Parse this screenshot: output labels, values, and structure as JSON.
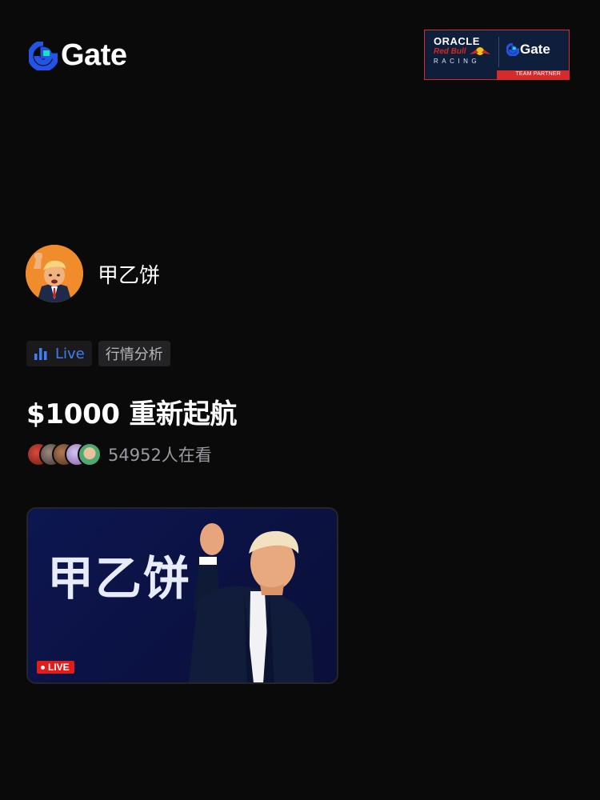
{
  "brand": {
    "name": "Gate",
    "accent": "#2354e6",
    "accent_secondary": "#17e3c2"
  },
  "partner_banner": {
    "line1": "ORACLE",
    "line2": "Red Bull",
    "line3": "RACING",
    "brand": "Gate",
    "badge": "TEAM PARTNER",
    "bg_color": "#0f1f3b",
    "accent_color": "#d62b2b"
  },
  "streamer": {
    "name": "甲乙饼",
    "avatar_icon": "cartoon-portrait-avatar"
  },
  "tags": {
    "live_label": "Live",
    "live_icon": "bar-chart-icon",
    "topic": "行情分析",
    "live_color": "#3f7ff5"
  },
  "stream": {
    "title": "$1000 重新起航",
    "viewers_text": "54952人在看"
  },
  "viewer_faces": [
    "#a8322a",
    "#6b5a4e",
    "#8a5a3c",
    "#b29ad6",
    "#4da872"
  ],
  "cover": {
    "overlay_text": "甲乙饼",
    "badge": "LIVE",
    "bg_color": "#0c1650"
  }
}
